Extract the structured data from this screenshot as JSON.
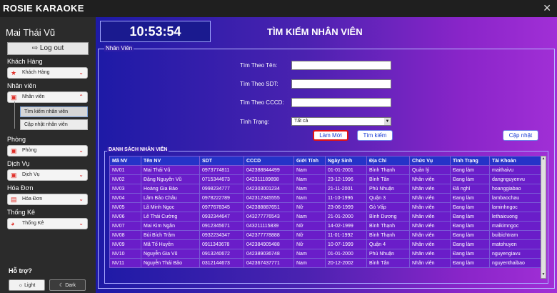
{
  "window": {
    "title": "ROSIE KARAOKE",
    "close": "✕"
  },
  "sidebar": {
    "user": "Mai Thái Vũ",
    "logout": "Log out",
    "sections": [
      {
        "label": "Khách Hàng",
        "dropdown": "Khách Hàng"
      },
      {
        "label": "Nhân viên",
        "dropdown": "Nhân viên"
      },
      {
        "label": "Phòng",
        "dropdown": "Phòng"
      },
      {
        "label": "Dịch Vụ",
        "dropdown": "Dịch Vụ"
      },
      {
        "label": "Hóa Đơn",
        "dropdown": "Hóa Đơn"
      },
      {
        "label": "Thống Kê",
        "dropdown": "Thống Kê"
      }
    ],
    "sub_items": [
      "Tìm kiếm nhân viên",
      "Cập nhật nhân viên"
    ],
    "help": "Hỗ trợ?",
    "light": "Light",
    "dark": "Dark"
  },
  "header": {
    "clock": "10:53:54",
    "title": "TÌM KIẾM NHÂN VIÊN"
  },
  "form": {
    "legend": "Nhân Viên",
    "name_label": "Tìm Theo Tên:",
    "phone_label": "Tìm Theo SDT:",
    "cccd_label": "Tìm Theo CCCD:",
    "status_label": "Tình Trạng:",
    "status_value": "Tất cả",
    "refresh": "Làm Mới",
    "search": "Tìm kiếm",
    "update": "Cập nhật"
  },
  "table": {
    "legend": "DANH SÁCH NHÂN VIÊN",
    "columns": [
      "Mã NV",
      "Tên NV",
      "SDT",
      "CCCD",
      "Giới Tính",
      "Ngày Sinh",
      "Địa Chỉ",
      "Chức Vụ",
      "Tình Trạng",
      "Tài Khoản"
    ],
    "rows": [
      [
        "NV01",
        "Mai Thái Vũ",
        "0973774811",
        "042388844499",
        "Nam",
        "01-01-2001",
        "Bình Thạnh",
        "Quản lý",
        "Đang làm",
        "maithaivu"
      ],
      [
        "NV02",
        "Đặng Nguyên Vũ",
        "0715344673",
        "042311189898",
        "Nam",
        "23-12-1996",
        "Bình Tân",
        "Nhân viên",
        "Đang làm",
        "dangnguyenvu"
      ],
      [
        "NV03",
        "Hoàng Gia Bảo",
        "0998234777",
        "042303001234",
        "Nam",
        "21-11-2001",
        "Phú Nhuận",
        "Nhân viên",
        "Đã nghỉ",
        "hoanggiabao"
      ],
      [
        "NV04",
        "Lâm Bảo Châu",
        "0978222789",
        "042312345555",
        "Nam",
        "11-10-1996",
        "Quận 3",
        "Nhân viên",
        "Đang làm",
        "lambaochau"
      ],
      [
        "NV05",
        "Lã Minh Ngọc",
        "0977678345",
        "042388887651",
        "Nữ",
        "23-06-1999",
        "Gò Vấp",
        "Nhân viên",
        "Đang làm",
        "laminhngoc"
      ],
      [
        "NV06",
        "Lê Thái Cường",
        "0932344647",
        "043277776543",
        "Nam",
        "21-01-2000",
        "Bình Dương",
        "Nhân viên",
        "Đang làm",
        "lethaicuong"
      ],
      [
        "NV07",
        "Mai Kim Ngân",
        "0912345671",
        "043211115839",
        "Nữ",
        "14-02-1999",
        "Bình Thạnh",
        "Nhân viên",
        "Đang làm",
        "maikimngoc"
      ],
      [
        "NV08",
        "Bùi Bích Trâm",
        "0932234347",
        "042377778888",
        "Nữ",
        "11-01-1992",
        "Bình Thạnh",
        "Nhân viên",
        "Đang làm",
        "buibichtram"
      ],
      [
        "NV09",
        "Mã Tố Huyền",
        "0911343678",
        "042384905488",
        "Nữ",
        "10-07-1999",
        "Quận 4",
        "Nhân viên",
        "Đang làm",
        "matohuyen"
      ],
      [
        "NV10",
        "Nguyễn Gia Vũ",
        "0913240672",
        "042389036748",
        "Nam",
        "01-01-2000",
        "Phú Nhuận",
        "Nhân viên",
        "Đang làm",
        "nguyengiavu"
      ],
      [
        "NV11",
        "Nguyễn Thái Bảo",
        "0312144673",
        "042367437771",
        "Nam",
        "20-12-2002",
        "Bình Tân",
        "Nhân viên",
        "Đang làm",
        "nguyenthaibao"
      ]
    ]
  },
  "colors": {
    "accent_red": "#e21212",
    "header_blue": "#2533c8",
    "row_purple": "#6a1dc9"
  }
}
